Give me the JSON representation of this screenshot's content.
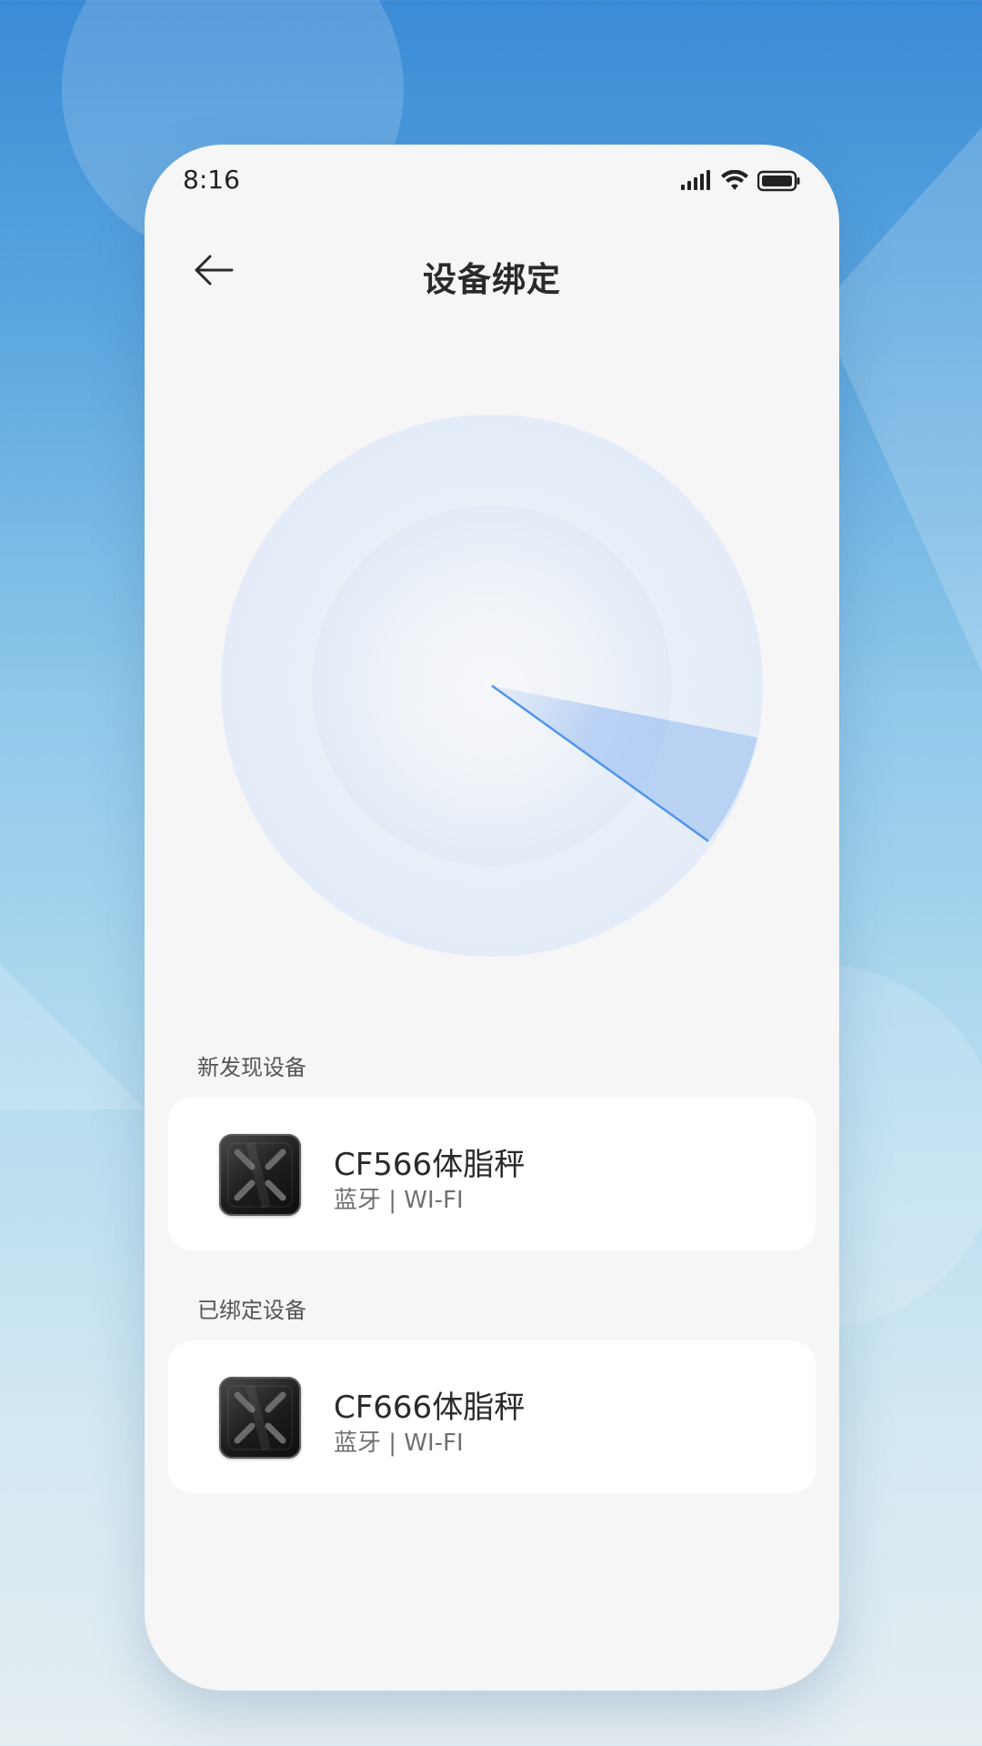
{
  "status_bar": {
    "time": "8:16",
    "icons": [
      "signal-icon",
      "wifi-icon",
      "battery-icon"
    ]
  },
  "nav": {
    "back_icon": "arrow-left-icon",
    "title": "设备绑定"
  },
  "radar": {
    "description_icon": "radar-scan-icon",
    "colors": {
      "ring": "#e3ecf8",
      "sweep": "#4f95ec"
    }
  },
  "sections": {
    "new_devices_label": "新发现设备",
    "bound_devices_label": "已绑定设备"
  },
  "new_devices": [
    {
      "name": "CF566体脂秤",
      "connectivity": "蓝牙 | WI-FI",
      "icon": "scale-icon"
    }
  ],
  "bound_devices": [
    {
      "name": "CF666体脂秤",
      "connectivity": "蓝牙 | WI-FI",
      "icon": "scale-icon"
    }
  ]
}
